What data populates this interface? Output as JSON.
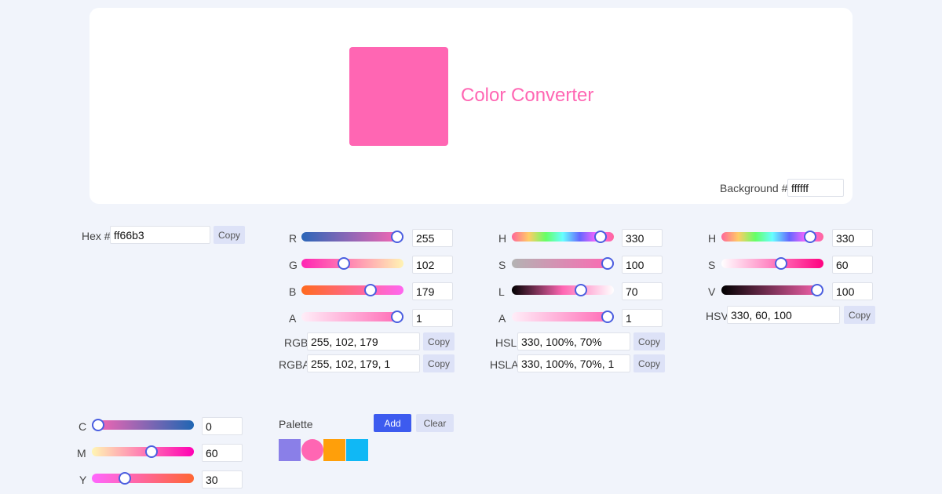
{
  "preview": {
    "title": "Color Converter",
    "swatch_color": "#ff66b3",
    "background_label": "Background #",
    "background_value": "ffffff"
  },
  "hex": {
    "label": "Hex #",
    "value": "ff66b3",
    "copy": "Copy"
  },
  "rgb": {
    "r": {
      "label": "R",
      "value": "255",
      "level": 1.0
    },
    "g": {
      "label": "G",
      "value": "102",
      "level": 0.4
    },
    "b": {
      "label": "B",
      "value": "179",
      "level": 0.702
    },
    "a": {
      "label": "A",
      "value": "1",
      "level": 1.0
    },
    "rgb_label": "RGB",
    "rgb_value": "255, 102, 179",
    "rgba_label": "RGBA",
    "rgba_value": "255, 102, 179, 1",
    "copy": "Copy"
  },
  "hsl": {
    "h": {
      "label": "H",
      "value": "330",
      "level": 0.917
    },
    "s": {
      "label": "S",
      "value": "100",
      "level": 1.0
    },
    "l": {
      "label": "L",
      "value": "70",
      "level": 0.7
    },
    "a": {
      "label": "A",
      "value": "1",
      "level": 1.0
    },
    "hsl_label": "HSL",
    "hsl_value": "330, 100%, 70%",
    "hsla_label": "HSLA",
    "hsla_value": "330, 100%, 70%, 1",
    "copy": "Copy"
  },
  "hsv": {
    "h": {
      "label": "H",
      "value": "330",
      "level": 0.917
    },
    "s": {
      "label": "S",
      "value": "60",
      "level": 0.6
    },
    "v": {
      "label": "V",
      "value": "100",
      "level": 1.0
    },
    "hsv_label": "HSV",
    "hsv_value": "330, 60, 100",
    "copy": "Copy"
  },
  "cmyk": {
    "c": {
      "label": "C",
      "value": "0",
      "level": 0.0
    },
    "m": {
      "label": "M",
      "value": "60",
      "level": 0.6
    },
    "y": {
      "label": "Y",
      "value": "30",
      "level": 0.3
    }
  },
  "palette": {
    "title": "Palette",
    "add": "Add",
    "clear": "Clear",
    "swatches": [
      {
        "color": "#8a7fe8",
        "shape": "square"
      },
      {
        "color": "#ff66b3",
        "shape": "circle"
      },
      {
        "color": "#ff9f0a",
        "shape": "square"
      },
      {
        "color": "#10b8f5",
        "shape": "square"
      }
    ]
  },
  "colors": {
    "accent": "#ff66b3",
    "primary_button": "#3d5bef",
    "secondary_button": "#dde2f7"
  }
}
